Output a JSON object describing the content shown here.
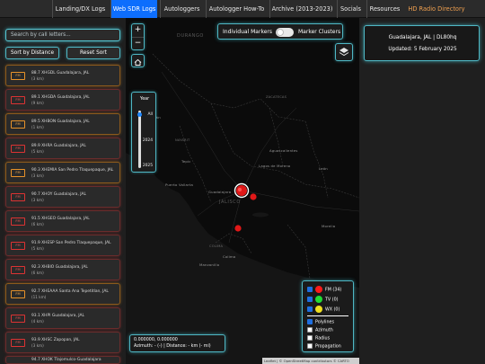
{
  "nav": {
    "items": [
      "Landing/DX Logs",
      "Web SDR Logs",
      "Autologgers",
      "Autologger How-To",
      "Archive (2013-2023)",
      "Socials",
      "Resources",
      "HD Radio Directory"
    ],
    "active": "Web SDR Logs"
  },
  "search": {
    "placeholder": "Search by call letters..."
  },
  "sort": {
    "distance_label": "Sort by Distance",
    "reset_label": "Reset Sort"
  },
  "stations": [
    {
      "tag": "FM",
      "hd": true,
      "line1": "88.7 XHGDL Guadalajara, JAL",
      "line2": "(3 km)"
    },
    {
      "tag": "FM",
      "hd": false,
      "line1": "89.1 XHGDA Guadalajara, JAL",
      "line2": "(9 km)"
    },
    {
      "tag": "FM",
      "hd": true,
      "line1": "89.5 XHBON Guadalajara, JAL",
      "line2": "(1 km)"
    },
    {
      "tag": "FM",
      "hd": false,
      "line1": "89.9 XHRA Guadalajara, JAL",
      "line2": "(5 km)"
    },
    {
      "tag": "FM",
      "hd": true,
      "line1": "90.3 XHEMIA San Pedro Tlaquepaque, JAL",
      "line2": "(3 km)"
    },
    {
      "tag": "FM",
      "hd": false,
      "line1": "90.7 XHOY Guadalajara, JAL",
      "line2": "(3 km)"
    },
    {
      "tag": "FM",
      "hd": false,
      "line1": "91.5 XHGEO Guadalajara, JAL",
      "line2": "(6 km)"
    },
    {
      "tag": "FM",
      "hd": false,
      "line1": "91.9 XHESP San Pedro Tlaquepaque, JAL",
      "line2": "(5 km)"
    },
    {
      "tag": "FM",
      "hd": false,
      "line1": "92.3 XHBIO Guadalajara, JAL",
      "line2": "(6 km)"
    },
    {
      "tag": "FM",
      "hd": true,
      "line1": "92.7 XHEAAA Santa Ana Tepetitlan, JAL",
      "line2": "(11 km)"
    },
    {
      "tag": "FM",
      "hd": false,
      "line1": "93.1 XHPI Guadalajara, JAL",
      "line2": "(4 km)"
    },
    {
      "tag": "FM",
      "hd": false,
      "line1": "93.9 XHSC Zapopan, JAL",
      "line2": "(3 km)"
    },
    {
      "tag": "FM",
      "hd": false,
      "line1": "94.7 XHOK Tlajomulco-Guadalajara",
      "line2": ""
    }
  ],
  "map": {
    "toggle": {
      "left_label": "Individual Markers",
      "right_label": "Marker Clusters"
    },
    "zoom": {
      "in": "+",
      "out": "−"
    },
    "year_slider": {
      "title": "Year",
      "labels": [
        "All",
        "2024",
        "2025"
      ],
      "selected": "All"
    },
    "labels": [
      {
        "text": "DURANGO",
        "big": true
      },
      {
        "text": "ZACATECAS",
        "big": false
      },
      {
        "text": "NAYARIT",
        "big": false
      },
      {
        "text": "JALISCO",
        "big": true
      },
      {
        "text": "COLIMA",
        "big": false
      },
      {
        "text": "Tepic",
        "big": false
      },
      {
        "text": "Aguascalientes",
        "big": false
      },
      {
        "text": "León",
        "big": false
      },
      {
        "text": "Guadalajara",
        "big": false
      },
      {
        "text": "Morelia",
        "big": false
      },
      {
        "text": "Colima",
        "big": false
      },
      {
        "text": "Mazatlán",
        "big": false
      },
      {
        "text": "Lagos de Moreno",
        "big": false
      },
      {
        "text": "Puerto Vallarta",
        "big": false
      },
      {
        "text": "Manzanillo",
        "big": false
      }
    ]
  },
  "info": {
    "location": "Guadalajara, JAL | DL80hq",
    "updated": "Updated: 5 February 2025"
  },
  "legend": {
    "items": [
      {
        "label": "FM (34)",
        "color": "#ff1a1a",
        "checked": true
      },
      {
        "label": "TV (0)",
        "color": "#22dd33",
        "checked": true
      },
      {
        "label": "WX (0)",
        "color": "#f0e020",
        "checked": true
      }
    ],
    "options": [
      {
        "label": "Polylines",
        "checked": true
      },
      {
        "label": "Azimuth",
        "checked": false
      },
      {
        "label": "Radius",
        "checked": false
      },
      {
        "label": "Propagation",
        "checked": false
      }
    ]
  },
  "coords": {
    "latlon": "0.000000, 0.000000",
    "readout": "Azimuth: - (-) | Distance: - km (- mi)"
  },
  "attribution": "Leaflet | © OpenStreetMap contributors © CARTO"
}
